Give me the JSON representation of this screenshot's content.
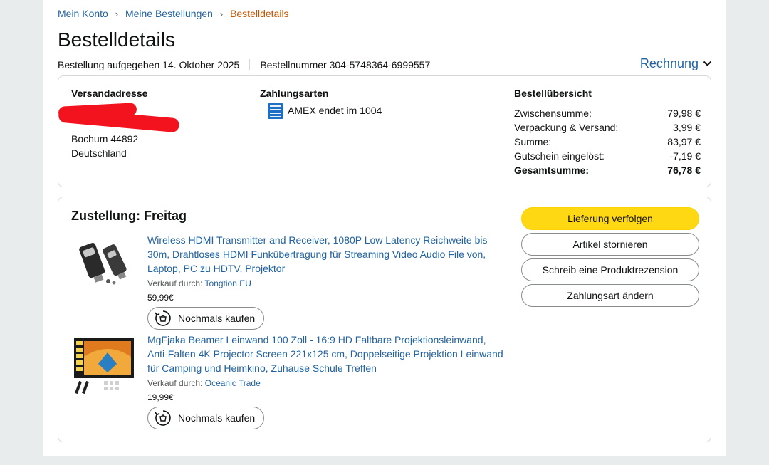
{
  "breadcrumb": {
    "items": [
      "Mein Konto",
      "Meine Bestellungen"
    ],
    "current": "Bestelldetails",
    "separator": "›"
  },
  "page_title": "Bestelldetails",
  "order_meta": {
    "placed": "Bestellung aufgegeben 14. Oktober 2025",
    "number": "Bestellnummer 304-5748364-6999557"
  },
  "invoice_label": "Rechnung",
  "shipping": {
    "heading": "Versandadresse",
    "city": "Bochum 44892",
    "country": "Deutschland"
  },
  "payment": {
    "heading": "Zahlungsarten",
    "method": "AMEX endet im 1004"
  },
  "summary": {
    "heading": "Bestellübersicht",
    "rows": [
      {
        "label": "Zwischensumme:",
        "value": "79,98 €"
      },
      {
        "label": "Verpackung & Versand:",
        "value": "3,99 €"
      },
      {
        "label": "Summe:",
        "value": "83,97 €"
      },
      {
        "label": "Gutschein eingelöst:",
        "value": "-7,19 €"
      },
      {
        "label": "Gesamtsumme:",
        "value": "76,78 €"
      }
    ]
  },
  "delivery": {
    "title": "Zustellung: Freitag",
    "actions": [
      "Lieferung verfolgen",
      "Artikel stornieren",
      "Schreib eine Produktrezension",
      "Zahlungsart ändern"
    ],
    "items": [
      {
        "title": "Wireless HDMI Transmitter and Receiver, 1080P Low Latency Reichweite bis 30m, Drahtloses HDMI Funkübertragung für Streaming Video Audio File von, Laptop, PC zu HDTV, Projektor",
        "seller_prefix": "Verkauf durch:",
        "seller": "Tongtion EU",
        "price": "59,99€",
        "buy_again": "Nochmals kaufen"
      },
      {
        "title": "MgFjaka Beamer Leinwand 100 Zoll - 16:9 HD Faltbare Projektionsleinwand, Anti-Falten 4K Projector Screen 221x125 cm, Doppelseitige Projektion Leinwand für Camping und Heimkino, Zuhause Schule Treffen",
        "seller_prefix": "Verkauf durch:",
        "seller": "Oceanic Trade",
        "price": "19,99€",
        "buy_again": "Nochmals kaufen"
      }
    ]
  },
  "colors": {
    "link": "#2162a1",
    "breadcrumb_current": "#c45500",
    "primary_button": "#ffd814",
    "redaction": "#f3131e",
    "amex": "#1c6fc4"
  }
}
